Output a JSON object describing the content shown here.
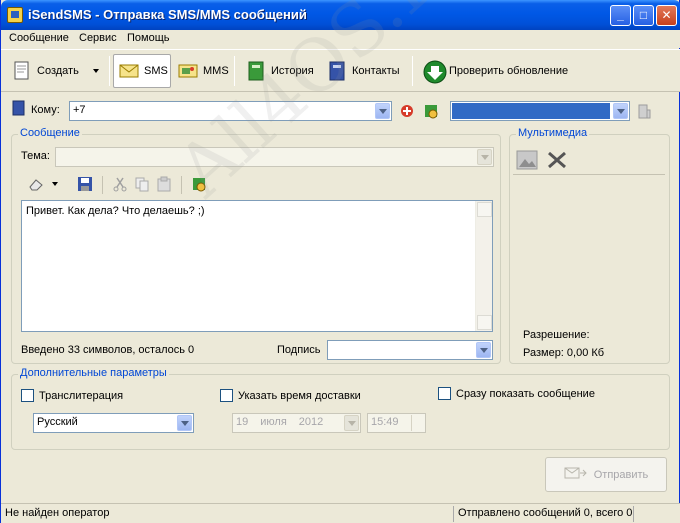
{
  "window": {
    "title": "iSendSMS - Отправка SMS/MMS сообщений",
    "controls": [
      "_",
      "□",
      "✕"
    ]
  },
  "menu": {
    "items": [
      "Сообщение",
      "Сервис",
      "Помощь"
    ]
  },
  "toolbar": {
    "create_label": "Создать",
    "sms_label": "SMS",
    "mms_label": "MMS",
    "history_label": "История",
    "contacts_label": "Контакты",
    "update_label": "Проверить обновление"
  },
  "recipient": {
    "label": "Кому:",
    "value": "+7"
  },
  "message": {
    "group_title": "Сообщение",
    "subject_label": "Тема:",
    "subject_value": "",
    "body": "Привет. Как дела? Что делаешь? ;)",
    "counter": "Введено 33 символов, осталось 0",
    "signature_label": "Подпись",
    "signature_value": ""
  },
  "multimedia": {
    "group_title": "Мультимедиа",
    "resolution_label": "Разрешение:",
    "size_label": "Размер: 0,00 Кб"
  },
  "options": {
    "group_title": "Дополнительные параметры",
    "translit_label": "Транслитерация",
    "translit_checked": false,
    "language_value": "Русский",
    "delivery_label": "Указать время доставки",
    "delivery_checked": false,
    "date_day": "19",
    "date_month": "июля",
    "date_year": "2012",
    "time_value": "15:49",
    "flash_label": "Сразу показать сообщение",
    "flash_checked": false
  },
  "send": {
    "label": "Отправить"
  },
  "status": {
    "operator": "Не найден оператор",
    "sent": "Отправлено сообщений 0, всего 0"
  },
  "watermark": "All4OS.RU",
  "colors": {
    "titlebar": "#0058e6",
    "group_title": "#0046d5",
    "window_bg": "#ece9d8",
    "account_select": "#316ac5"
  }
}
